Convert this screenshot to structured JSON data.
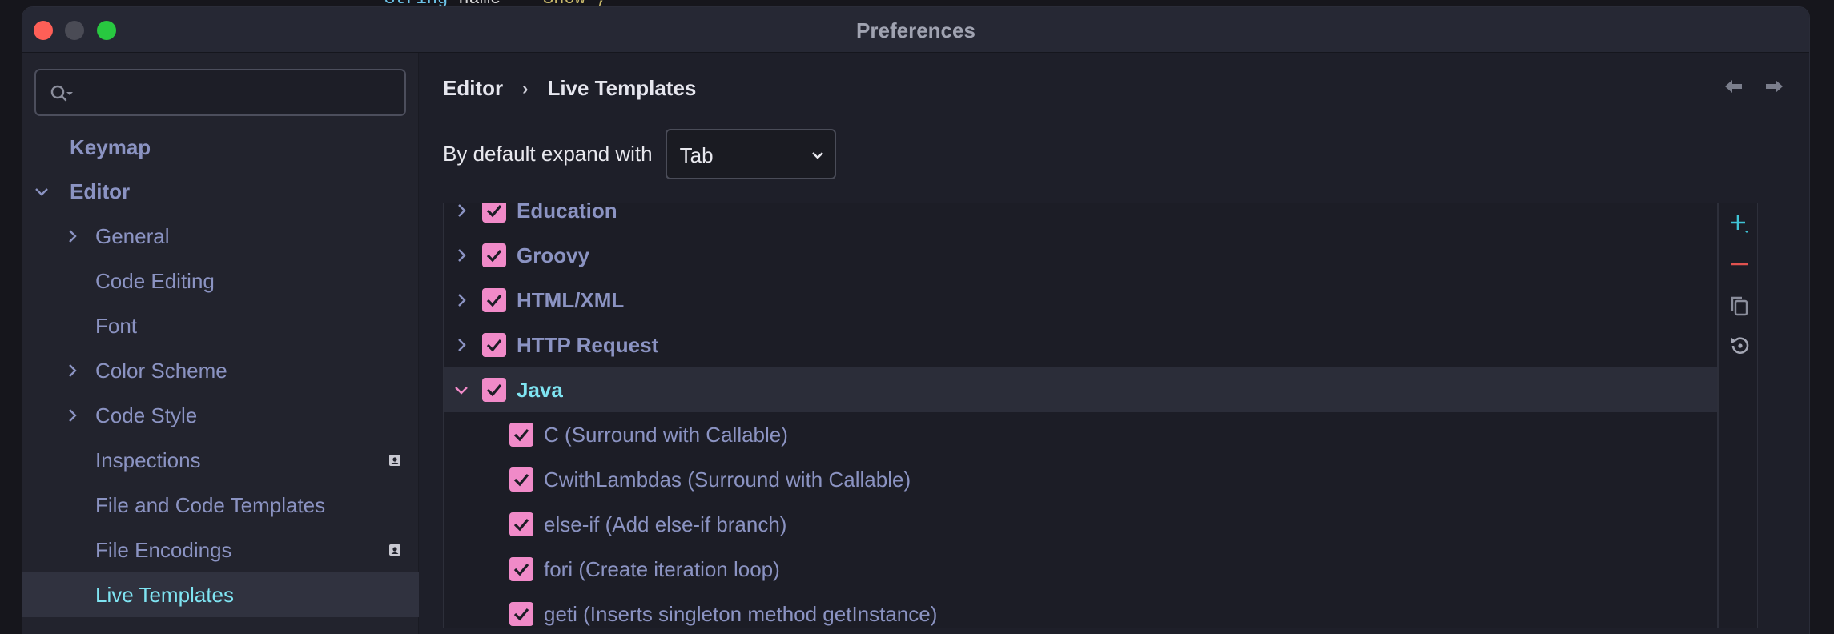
{
  "behind_code": {
    "type": "String",
    "var": "name",
    "eq": "=",
    "value": "\"Show\";"
  },
  "window": {
    "title": "Preferences"
  },
  "search": {
    "placeholder": ""
  },
  "sidebar": {
    "items": [
      {
        "label": "Keymap"
      },
      {
        "label": "Editor"
      },
      {
        "label": "General"
      },
      {
        "label": "Code Editing"
      },
      {
        "label": "Font"
      },
      {
        "label": "Color Scheme"
      },
      {
        "label": "Code Style"
      },
      {
        "label": "Inspections"
      },
      {
        "label": "File and Code Templates"
      },
      {
        "label": "File Encodings"
      },
      {
        "label": "Live Templates"
      }
    ]
  },
  "breadcrumb": {
    "parent": "Editor",
    "separator": "›",
    "current": "Live Templates"
  },
  "expand": {
    "label": "By default expand with",
    "value": "Tab"
  },
  "tree": {
    "groups": [
      {
        "label": "Education"
      },
      {
        "label": "Groovy"
      },
      {
        "label": "HTML/XML"
      },
      {
        "label": "HTTP Request"
      },
      {
        "label": "Java"
      }
    ],
    "java_items": [
      {
        "label": "C (Surround with Callable)"
      },
      {
        "label": "CwithLambdas (Surround with Callable)"
      },
      {
        "label": "else-if (Add else-if branch)"
      },
      {
        "label": "fori (Create iteration loop)"
      },
      {
        "label": "geti (Inserts singleton method getInstance)"
      }
    ]
  },
  "colors": {
    "accent": "#7fe4f2",
    "checkbox": "#f08ac8",
    "text": "#8b93c2",
    "add": "#3fc4d6",
    "remove": "#e0524f"
  }
}
